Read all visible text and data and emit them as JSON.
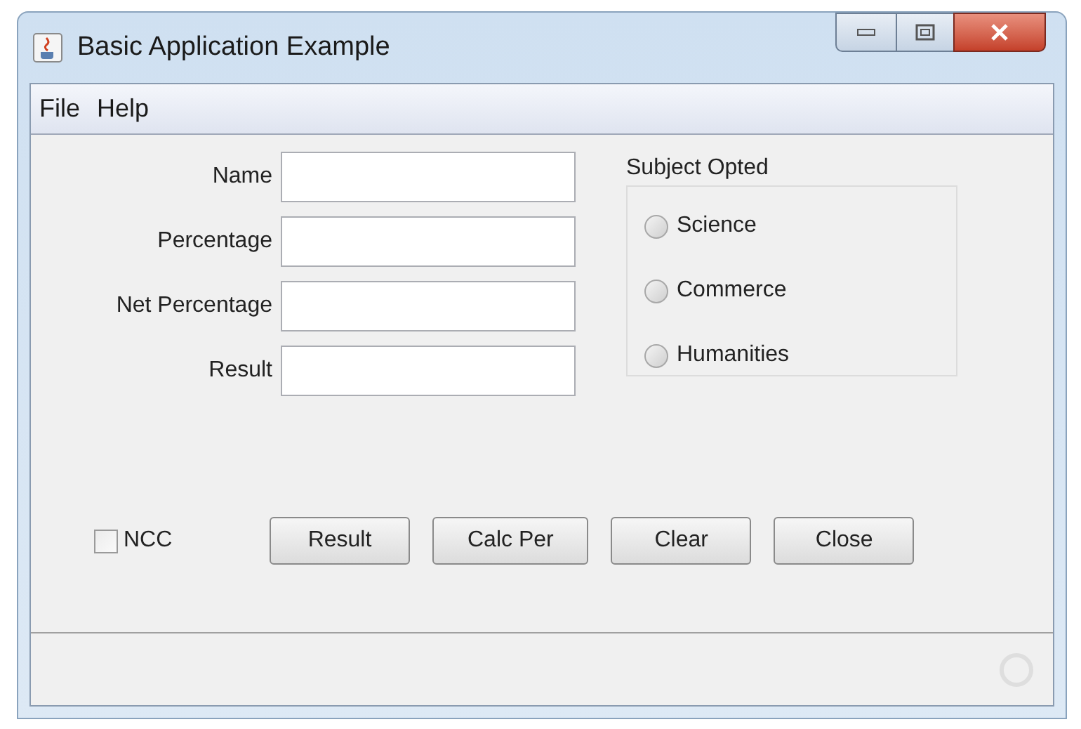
{
  "window": {
    "title": "Basic Application Example"
  },
  "menu": [
    "File",
    "Help"
  ],
  "fields": [
    {
      "label": "Name"
    },
    {
      "label": "Percentage"
    },
    {
      "label": "Net Percentage"
    },
    {
      "label": "Result"
    }
  ],
  "subject_group": {
    "title": "Subject Opted",
    "options": [
      {
        "label": "Science",
        "selected": false
      },
      {
        "label": "Commerce",
        "selected": false
      },
      {
        "label": "Humanities",
        "selected": false
      }
    ]
  },
  "ncc": {
    "label": "NCC",
    "checked": false
  },
  "buttons": [
    "Result",
    "Calc Per",
    "Clear",
    "Close"
  ]
}
